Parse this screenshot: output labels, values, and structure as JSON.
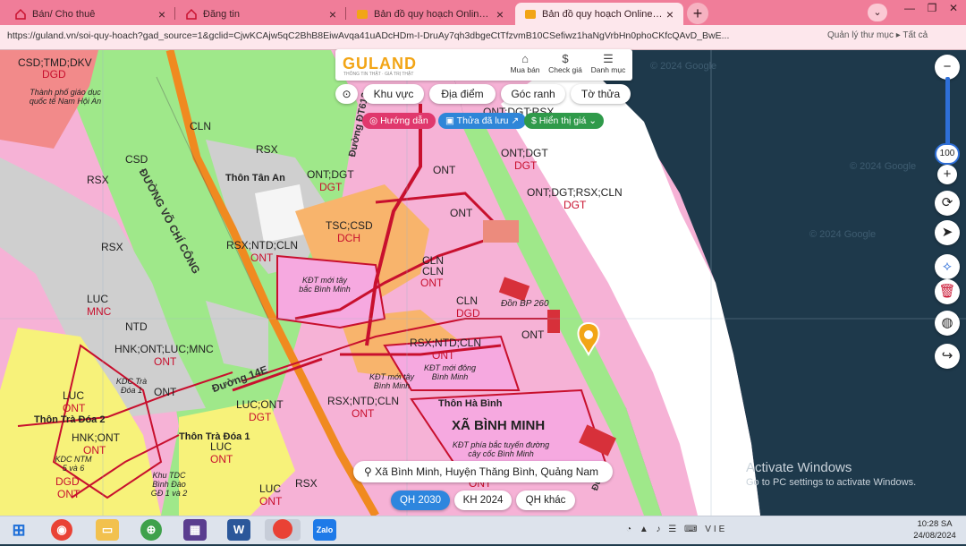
{
  "tabs": [
    {
      "title": "Bán/ Cho thuê",
      "active": false
    },
    {
      "title": "Đăng tin",
      "active": false
    },
    {
      "title": "Bản đồ quy hoạch Online trực tu",
      "active": false
    },
    {
      "title": "Bản đồ quy hoạch Online trực tu",
      "active": true
    }
  ],
  "address_bar": {
    "url": "https://guland.vn/soi-quy-hoach?gad_source=1&gclid=CjwKCAjw5qC2BhB8EiwAvqa41uADcHDm-I-DruAy7qh3dbgeCtTfzvmB10CSefiwz1haNgVrbHn0phoCKfcQAvD_BwE...",
    "right_text": "Quản lý thư mục ▸ Tất cả"
  },
  "brand": {
    "logo": "GULAND",
    "tagline": "THÔNG TIN THẬT · GIÁ TRỊ THẬT"
  },
  "top_actions": [
    {
      "label": "Mua bán",
      "icon": "house-icon"
    },
    {
      "label": "Check giá",
      "icon": "dollar-icon"
    },
    {
      "label": "Danh mục",
      "icon": "menu-icon"
    }
  ],
  "search_modes": [
    "Khu vực",
    "Địa điểm",
    "Góc ranh",
    "Tờ thửa"
  ],
  "chips": {
    "guide": "Hướng dẫn",
    "saved": "Thửa đã lưu",
    "price": "Hiển thị giá"
  },
  "zoom": {
    "level": "100",
    "minus": "−",
    "plus": "+"
  },
  "location": "Xã Bình Minh, Huyện Thăng Bình, Quảng Nam",
  "plan_tabs": [
    "QH 2030",
    "KH 2024",
    "QH khác"
  ],
  "activate": {
    "line1": "Activate Windows",
    "line2": "Go to PC settings to activate Windows."
  },
  "map_watermark": "© 2024 Google",
  "map_labels": {
    "zone1": "CSD;TMD;DKV",
    "zone1b": "DGD",
    "city": "Thành phố giáo dục quốc tế Nam Hội An",
    "road1": "ĐƯỜNG VÕ CHÍ CÔNG",
    "road2": "Đường ĐT613",
    "road3": "Đường 14E",
    "cln1": "CLN",
    "rsx1": "RSX",
    "csd1": "CSD",
    "rsx2": "RSX",
    "rsx3": "RSX",
    "tanan": "Thôn Tân An",
    "ontdgt1": "ONT;DGT",
    "dgt1": "DGT",
    "ont1": "ONT",
    "ont2": "ONT",
    "ontdgt2": "ONT;DGT",
    "dgt2": "DGT",
    "ontdgtrsx": "ONT;DGT;RSX;CLN",
    "dgt3": "DGT",
    "ontdgtrsx_top": "ONT;DGT;RSX",
    "tsc": "TSC;CSD",
    "dch": "DCH",
    "rsxntd": "RSX;NTD;CLN",
    "ont3": "ONT",
    "kdt1": "KĐT mới tây bắc Bình Minh",
    "cln2": "CLN",
    "cln3": "CLN",
    "ont4": "ONT",
    "cln4": "CLN",
    "dgd2": "DGD",
    "donbp": "Đồn BP 260",
    "luc1": "LUC",
    "mnc": "MNC",
    "ntd": "NTD",
    "hnk": "HNK;ONT;LUC;MNC",
    "ont5": "ONT",
    "rsxntd2": "RSX;NTD;CLN",
    "ont6": "ONT",
    "ont7": "ONT",
    "kdt2": "KĐT mới tây Bình Minh",
    "kdt3": "KĐT mới đông Bình Minh",
    "rsxntd3": "RSX;NTD;CLN",
    "ont8": "ONT",
    "thonhabinh": "Thôn Hà Bình",
    "xabinhminh": "XÃ BÌNH MINH",
    "kdt4": "KĐT phía bắc tuyến đường cây cốc Bình Minh",
    "kdc": "KDC Trà Đóa 1",
    "luc2": "LUC",
    "ont9": "ONT",
    "ont10": "ONT",
    "thontradoa2": "Thôn Trà Đóa 2",
    "hnkont": "HNK;ONT",
    "ont11": "ONT",
    "lucont": "LUC;ONT",
    "dgt4": "DGT",
    "thontradoa1": "Thôn Trà Đóa 1",
    "luc3": "LUC",
    "ont12": "ONT",
    "kdcntm": "KDC NTM 5 và 6",
    "dgd3": "DGD",
    "ont13": "ONT",
    "khutdc": "Khu TDC Bình Đào GĐ 1 và 2",
    "luc4": "LUC",
    "ont14": "ONT",
    "rsx4": "RSX",
    "ont15": "ONT",
    "road4": "Đường"
  },
  "taskbar": {
    "apps": [
      "windows-start",
      "chrome",
      "file-explorer",
      "maps",
      "app-store",
      "word",
      "chrome-active",
      "zalo"
    ],
    "tray": "VIE",
    "time": "10:28 SA",
    "date": "24/08/2024"
  }
}
